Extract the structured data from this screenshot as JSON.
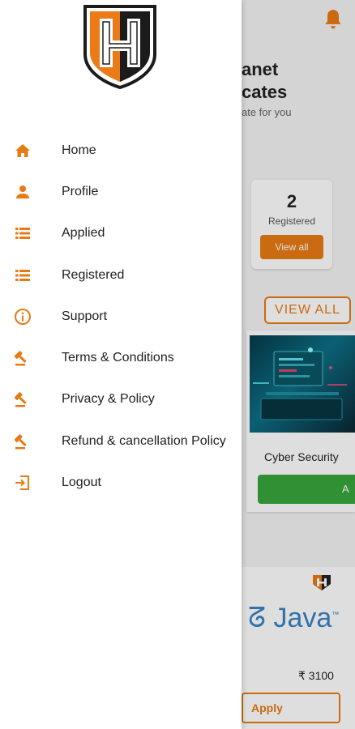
{
  "colors": {
    "accent": "#e87a14",
    "green": "#38a63c",
    "java_blue": "#3a83c5"
  },
  "background": {
    "hero": {
      "title_line1": "anet",
      "title_line2": "cates",
      "subtitle": "ate for you"
    },
    "registered_card": {
      "count": "2",
      "label": "Registered",
      "button": "View all"
    },
    "view_all_button": "VIEW ALL",
    "course_card": {
      "title": "Cyber Security",
      "apply_label": "A"
    },
    "java_card": {
      "title": "Java",
      "trademark": "™",
      "price": "₹ 3100",
      "apply_label": "Apply"
    }
  },
  "drawer": {
    "menu": [
      {
        "id": "home",
        "label": "Home",
        "icon": "home-icon"
      },
      {
        "id": "profile",
        "label": "Profile",
        "icon": "person-icon"
      },
      {
        "id": "applied",
        "label": "Applied",
        "icon": "list-icon"
      },
      {
        "id": "registered",
        "label": "Registered",
        "icon": "list-icon"
      },
      {
        "id": "support",
        "label": "Support",
        "icon": "info-icon"
      },
      {
        "id": "terms",
        "label": "Terms & Conditions",
        "icon": "gavel-icon"
      },
      {
        "id": "privacy",
        "label": "Privacy & Policy",
        "icon": "gavel-icon"
      },
      {
        "id": "refund",
        "label": "Refund & cancellation Policy",
        "icon": "gavel-icon"
      },
      {
        "id": "logout",
        "label": "Logout",
        "icon": "logout-icon"
      }
    ]
  }
}
